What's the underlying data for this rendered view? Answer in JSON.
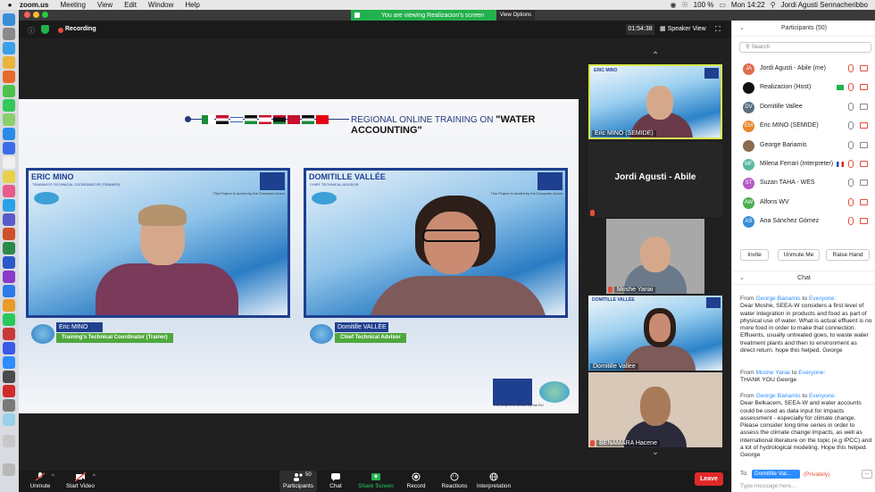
{
  "menubar": {
    "app": "zoom.us",
    "items": [
      "Meeting",
      "View",
      "Edit",
      "Window",
      "Help"
    ],
    "battery": "100 %",
    "clock": "Mon 14:22",
    "user": "Jordi Agusti Sennacheribbo"
  },
  "banner": {
    "viewing": "You are viewing Realizacion's screen",
    "view_options": "View Options"
  },
  "topbar": {
    "recording": "Recording",
    "timer": "01:54:38",
    "speaker_view": "Speaker View"
  },
  "slide": {
    "title_prefix": "REGIONAL ONLINE TRAINING ON",
    "title_main": "\"WATER ACCOUNTING\"",
    "speaker1": {
      "name": "ERIC MINO",
      "sub": "TRAINING'S TECHNICAL COORDINATOR (TRAINER)",
      "plate_name": "Eric MINO",
      "plate_role": "Training's Technical Coordinator (Trainer)"
    },
    "speaker2": {
      "name": "DOMITILLE VALLÉE",
      "sub": "CHIEF TECHNICAL ADVISOR",
      "plate_name": "Domitille VALLÉE",
      "plate_role": "Chief Technical Advisor"
    },
    "eu_text": "This Project is funded by the European Union",
    "eu_caption": "This project is funded by the EU"
  },
  "tiles": [
    {
      "name": "Eric MINO (SEMIDE)"
    },
    {
      "name": "Jordi Agusti - Abile"
    },
    {
      "name": "Moshe Yanai"
    },
    {
      "name": "Domitille Vallee"
    },
    {
      "name": "BENAMARA Hacene"
    }
  ],
  "tile_label": "ERIC MINO",
  "tile_label2": "DOMITILLE VALLÉE",
  "toolbar": {
    "unmute": "Unmute",
    "start_video": "Start Video",
    "participants": "Participants",
    "participants_count": "50",
    "chat": "Chat",
    "share_screen": "Share Screen",
    "record": "Record",
    "reactions": "Reactions",
    "interpretation": "Interpretation",
    "leave": "Leave"
  },
  "participants_panel": {
    "title": "Participants (50)",
    "search_placeholder": "Search",
    "rows": [
      {
        "initials": "JA",
        "name": "Jordi Agusti - Abile (me)",
        "color": "#e06b4a"
      },
      {
        "initials": "",
        "name": "Realizacion (Host)",
        "color": "#111111"
      },
      {
        "initials": "DV",
        "name": "Domitille Vallee",
        "color": "#5a6f7f"
      },
      {
        "initials": "EM",
        "name": "Eric MINO (SEMIDE)",
        "color": "#e8862a"
      },
      {
        "initials": "",
        "name": "George Bariamis",
        "color": "#8a6a50"
      },
      {
        "initials": "MF",
        "name": "Milena Ferrari (Interpreter)",
        "color": "#58b8a0"
      },
      {
        "initials": "ST",
        "name": "Suzan TAHA - WES",
        "color": "#b45ac8"
      },
      {
        "initials": "AW",
        "name": "Alfons WV",
        "color": "#4caf50"
      },
      {
        "initials": "AS",
        "name": "Ana Sánchez Gómez",
        "color": "#3a8ed8"
      }
    ],
    "invite": "Invite",
    "unmute_me": "Unmute Me",
    "raise_hand": "Raise Hand"
  },
  "chat": {
    "title": "Chat",
    "from_label": "From",
    "to_label": "to",
    "messages": [
      {
        "from": "George Bariamis",
        "to": "Everyone:",
        "text": "Dear Moshe, SEEA-W considers a first level of water integration in products and food as part of physical use of water. What is actual effluent is no more food in order to make that connection. Effluents, usually untreated goes, to waste water treatment plants and then to environment as direct return. hope this helped. George"
      },
      {
        "from": "Moshe Yanai",
        "to": "Everyone:",
        "text": "THANK YOU George"
      },
      {
        "from": "George Bariamis",
        "to": "Everyone:",
        "text": "Dear Belkacem, SEEA-W and water accounts could be used as data input for impacts assessment - especially for climate change. Please consider long time series in order to assess the climate change impacts, as well as international literature on the topic (e.g IPCC) and a lot of hydrological modeling. Hope this helped. George"
      }
    ],
    "to_prefix": "To:",
    "to_value": "Domitille Val...",
    "privately": "(Privately)",
    "more": "...",
    "input_placeholder": "Type message here..."
  }
}
